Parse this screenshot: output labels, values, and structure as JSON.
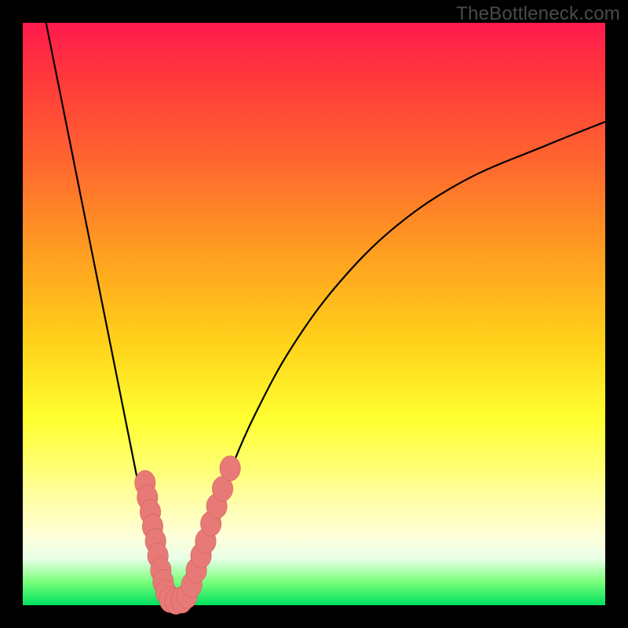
{
  "watermark": "TheBottleneck.com",
  "colors": {
    "frame": "#000000",
    "curve": "#000000",
    "marker_fill": "#e77a76",
    "marker_stroke": "#c95a56"
  },
  "chart_data": {
    "type": "line",
    "title": "",
    "xlabel": "",
    "ylabel": "",
    "xlim": [
      0,
      100
    ],
    "ylim": [
      0,
      100
    ],
    "grid": false,
    "legend": false,
    "series": [
      {
        "name": "bottleneck-curve-left",
        "x": [
          4.0,
          6.0,
          8.0,
          10.0,
          12.0,
          14.0,
          16.0,
          18.0,
          20.0,
          22.0,
          23.5,
          24.5
        ],
        "y": [
          100.0,
          90.0,
          80.0,
          70.0,
          60.0,
          50.0,
          40.0,
          30.0,
          20.0,
          10.0,
          4.0,
          1.0
        ]
      },
      {
        "name": "bottleneck-curve-right",
        "x": [
          28.0,
          29.0,
          30.5,
          33.0,
          36.0,
          40.0,
          46.0,
          54.0,
          64.0,
          76.0,
          90.0,
          100.0
        ],
        "y": [
          1.0,
          3.0,
          8.0,
          16.0,
          24.0,
          33.0,
          44.0,
          55.0,
          65.0,
          73.0,
          79.0,
          83.0
        ]
      }
    ],
    "markers": {
      "name": "data-points",
      "shape": "rounded-capsule",
      "points": [
        {
          "x": 21.0,
          "y": 21.0,
          "r": 1.2
        },
        {
          "x": 21.4,
          "y": 18.5,
          "r": 1.2
        },
        {
          "x": 21.9,
          "y": 16.0,
          "r": 1.2
        },
        {
          "x": 22.3,
          "y": 13.5,
          "r": 1.2
        },
        {
          "x": 22.8,
          "y": 11.0,
          "r": 1.2
        },
        {
          "x": 23.2,
          "y": 8.5,
          "r": 1.2
        },
        {
          "x": 23.7,
          "y": 6.0,
          "r": 1.2
        },
        {
          "x": 24.1,
          "y": 4.0,
          "r": 1.2
        },
        {
          "x": 24.6,
          "y": 2.2,
          "r": 1.2
        },
        {
          "x": 25.3,
          "y": 1.0,
          "r": 1.3
        },
        {
          "x": 26.3,
          "y": 0.7,
          "r": 1.3
        },
        {
          "x": 27.3,
          "y": 0.9,
          "r": 1.3
        },
        {
          "x": 28.2,
          "y": 1.6,
          "r": 1.2
        },
        {
          "x": 29.0,
          "y": 3.5,
          "r": 1.2
        },
        {
          "x": 29.8,
          "y": 6.0,
          "r": 1.2
        },
        {
          "x": 30.6,
          "y": 8.5,
          "r": 1.2
        },
        {
          "x": 31.4,
          "y": 11.0,
          "r": 1.2
        },
        {
          "x": 32.3,
          "y": 14.0,
          "r": 1.2
        },
        {
          "x": 33.3,
          "y": 17.0,
          "r": 1.2
        },
        {
          "x": 34.3,
          "y": 20.0,
          "r": 1.2
        },
        {
          "x": 35.6,
          "y": 23.5,
          "r": 1.2
        }
      ]
    }
  }
}
